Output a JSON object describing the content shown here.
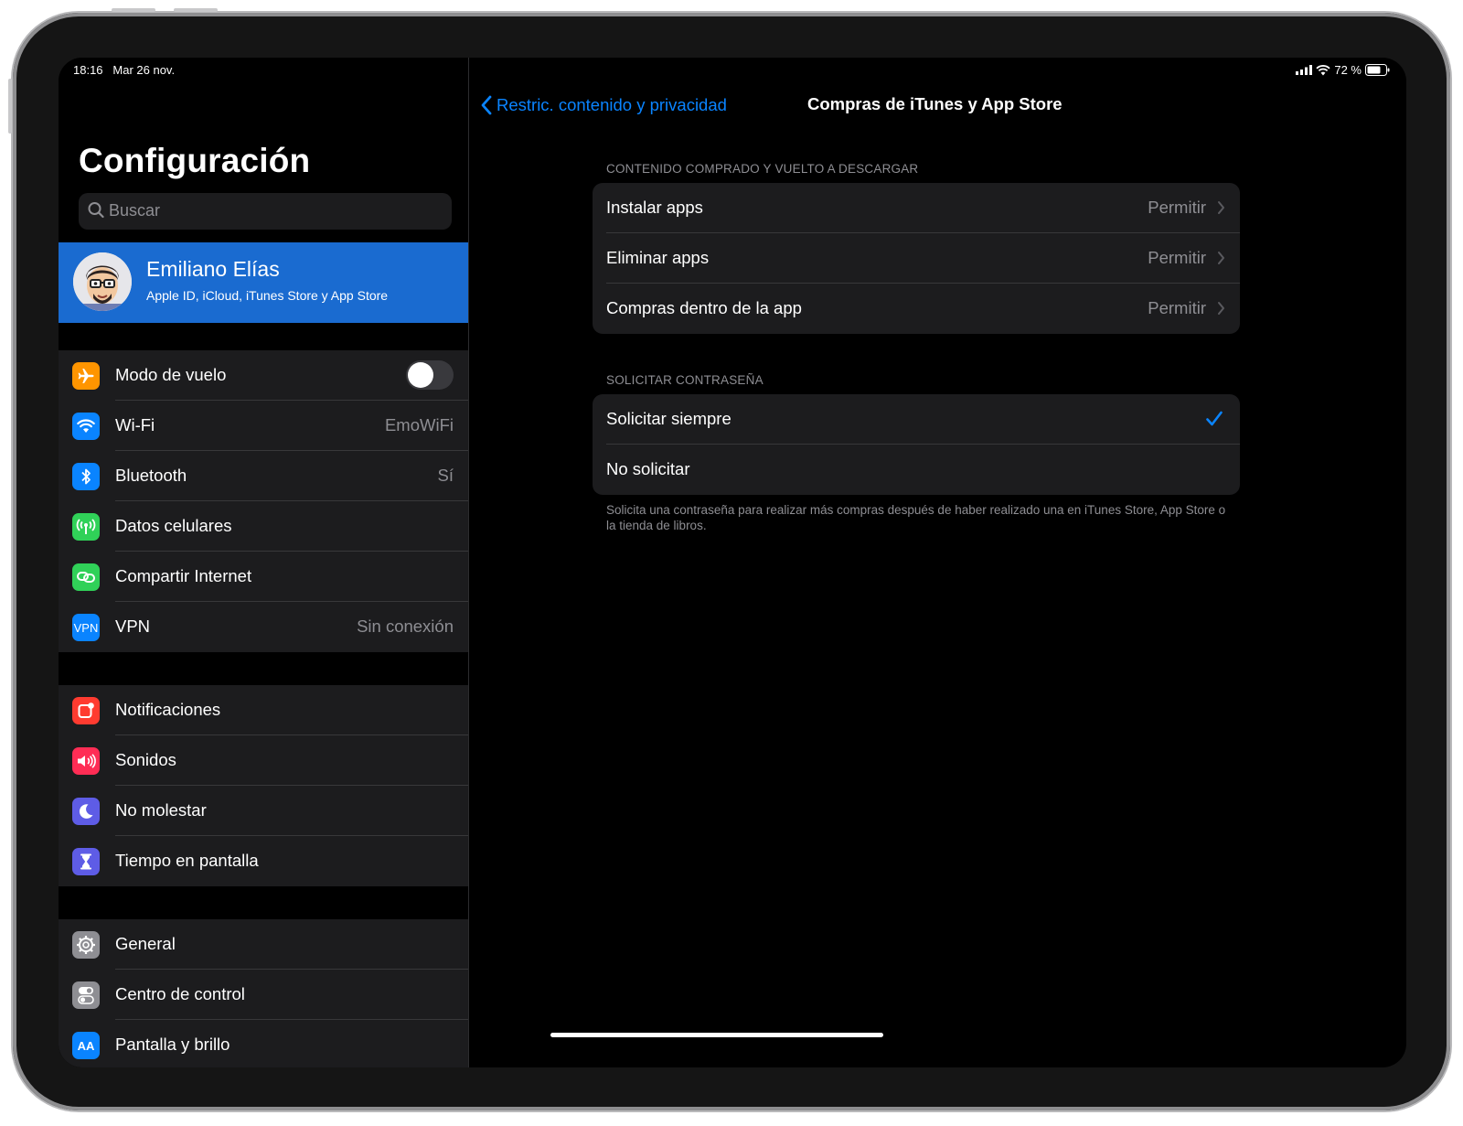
{
  "status_bar": {
    "time": "18:16",
    "date": "Mar 26 nov.",
    "battery": "72 %"
  },
  "sidebar": {
    "title": "Configuración",
    "search_placeholder": "Buscar",
    "profile": {
      "name": "Emiliano Elías",
      "subtitle": "Apple ID, iCloud, iTunes Store y App Store"
    },
    "groups": [
      {
        "items": [
          {
            "label": "Modo de vuelo",
            "icon": "airplane-icon",
            "color": "#ff9500",
            "toggle": false
          },
          {
            "label": "Wi-Fi",
            "value": "EmoWiFi",
            "icon": "wifi-icon",
            "color": "#0a84ff"
          },
          {
            "label": "Bluetooth",
            "value": "Sí",
            "icon": "bluetooth-icon",
            "color": "#0a84ff"
          },
          {
            "label": "Datos celulares",
            "icon": "cellular-icon",
            "color": "#30d158"
          },
          {
            "label": "Compartir Internet",
            "icon": "hotspot-icon",
            "color": "#30d158"
          },
          {
            "label": "VPN",
            "value": "Sin conexión",
            "icon": "vpn-icon",
            "icon_text": "VPN",
            "color": "#0a84ff"
          }
        ]
      },
      {
        "items": [
          {
            "label": "Notificaciones",
            "icon": "notifications-icon",
            "color": "#ff3b30"
          },
          {
            "label": "Sonidos",
            "icon": "sounds-icon",
            "color": "#ff2d55"
          },
          {
            "label": "No molestar",
            "icon": "moon-icon",
            "color": "#5e5ce6"
          },
          {
            "label": "Tiempo en pantalla",
            "icon": "hourglass-icon",
            "color": "#5e5ce6"
          }
        ]
      },
      {
        "items": [
          {
            "label": "General",
            "icon": "gear-icon",
            "color": "#8e8e93"
          },
          {
            "label": "Centro de control",
            "icon": "switches-icon",
            "color": "#8e8e93"
          },
          {
            "label": "Pantalla y brillo",
            "icon": "display-icon",
            "icon_text": "AA",
            "color": "#0a84ff"
          }
        ]
      }
    ]
  },
  "detail": {
    "back_label": "Restric. contenido y privacidad",
    "title": "Compras de iTunes y App Store",
    "section1": {
      "header": "CONTENIDO COMPRADO Y VUELTO A DESCARGAR",
      "rows": [
        {
          "label": "Instalar apps",
          "value": "Permitir"
        },
        {
          "label": "Eliminar apps",
          "value": "Permitir"
        },
        {
          "label": "Compras dentro de la app",
          "value": "Permitir"
        }
      ]
    },
    "section2": {
      "header": "SOLICITAR CONTRASEÑA",
      "rows": [
        {
          "label": "Solicitar siempre",
          "selected": true
        },
        {
          "label": "No solicitar",
          "selected": false
        }
      ],
      "footer": "Solicita una contraseña para realizar más compras después de haber realizado una en iTunes Store, App Store o la tienda de libros."
    }
  },
  "colors": {
    "accent": "#0a84ff",
    "profile_bg": "#1a6bd0"
  }
}
